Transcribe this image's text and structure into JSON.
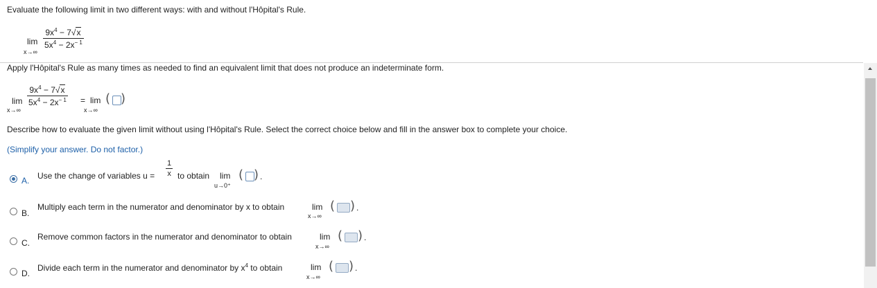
{
  "question": {
    "prompt": "Evaluate the following limit in two different ways: with and without l'Hôpital's Rule.",
    "lim": "lim",
    "lim_sub": "x→∞",
    "num_a": "9x",
    "num_exp": "4",
    "num_b": " − 7",
    "num_rad": "x",
    "den_a": "5x",
    "den_exp": "4",
    "den_b": " − 2x",
    "den_exp2": "− 1"
  },
  "part1": {
    "instruction": "Apply l'Hôpital's Rule as many times as needed to find an equivalent limit that does not produce an indeterminate form.",
    "equals": "=",
    "rhs_lim": "lim",
    "rhs_sub": "x→∞"
  },
  "part2": {
    "instruction": "Describe how to evaluate the given limit without using l'Hôpital's Rule. Select the correct choice below and fill in the answer box to complete your choice.",
    "hint": "(Simplify your answer. Do not factor.)"
  },
  "choices": [
    {
      "letter": "A.",
      "selected": true,
      "text_before": "Use the change of variables u =",
      "frac_num": "1",
      "frac_den": "x",
      "text_after": "to obtain",
      "lim": "lim",
      "sub": "u→0⁺"
    },
    {
      "letter": "B.",
      "selected": false,
      "text": "Multiply each term in the numerator and denominator by x to obtain",
      "lim": "lim",
      "sub": "x→∞"
    },
    {
      "letter": "C.",
      "selected": false,
      "text": "Remove common factors in the numerator and denominator to obtain",
      "lim": "lim",
      "sub": "x→∞"
    },
    {
      "letter": "D.",
      "selected": false,
      "text_before": "Divide each term in the numerator and denominator by x",
      "exp": "4",
      "text_after": "to obtain",
      "lim": "lim",
      "sub": "x→∞"
    }
  ],
  "colors": {
    "accent": "#1c5fa8",
    "box_border": "#6a8fb8"
  }
}
